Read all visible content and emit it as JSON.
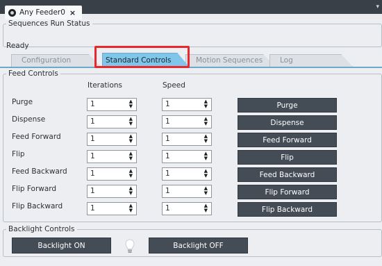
{
  "doc_tab": {
    "title": "Any Feeder0",
    "close": "×"
  },
  "status": {
    "legend": "Sequences Run Status",
    "text": "Ready"
  },
  "tabs": [
    "Configuration",
    "Standard Controls",
    "Motion Sequences",
    "Log"
  ],
  "feed": {
    "legend": "Feed Controls",
    "col_iterations": "Iterations",
    "col_speed": "Speed",
    "rows": [
      {
        "label": "Purge",
        "iterations": "1",
        "speed": "1",
        "button": "Purge"
      },
      {
        "label": "Dispense",
        "iterations": "1",
        "speed": "1",
        "button": "Dispense"
      },
      {
        "label": "Feed Forward",
        "iterations": "1",
        "speed": "1",
        "button": "Feed Forward"
      },
      {
        "label": "Flip",
        "iterations": "1",
        "speed": "1",
        "button": "Flip"
      },
      {
        "label": "Feed Backward",
        "iterations": "1",
        "speed": "1",
        "button": "Feed Backward"
      },
      {
        "label": "Flip Forward",
        "iterations": "1",
        "speed": "1",
        "button": "Flip Forward"
      },
      {
        "label": "Flip Backward",
        "iterations": "1",
        "speed": "1",
        "button": "Flip Backward"
      }
    ]
  },
  "backlight": {
    "legend": "Backlight Controls",
    "on": "Backlight ON",
    "off": "Backlight OFF",
    "bulb_icon": "lightbulb-icon"
  },
  "colors": {
    "accent_tab": "#7fc6ea",
    "highlight": "#e8282b",
    "button": "#444c56"
  }
}
